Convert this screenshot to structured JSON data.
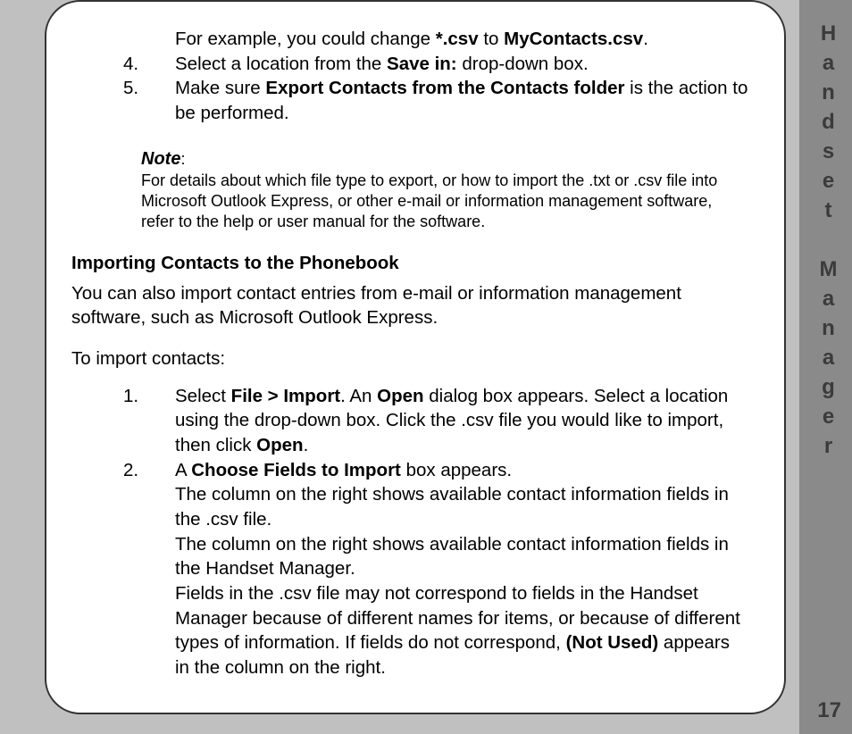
{
  "sideTab": "Handset Manager",
  "pageNumber": "17",
  "topExample": {
    "pre": "For example, you could change ",
    "b1": "*.csv",
    "mid": " to ",
    "b2": "MyContacts.csv",
    "post": "."
  },
  "list1": {
    "item4": {
      "num": "4.",
      "pre": "Select a location from the ",
      "b": "Save in:",
      "post": "  drop-down box."
    },
    "item5": {
      "num": "5.",
      "pre": "Make sure ",
      "b": "Export Contacts from the Contacts folder",
      "post": " is the action to be performed."
    }
  },
  "note": {
    "label": "Note",
    "colon": ":",
    "text": "For details about which file type to export, or how to import the .txt or .csv file into Microsoft Outlook Express, or other e-mail or information management software, refer to the help or user manual for the software."
  },
  "heading": "Importing Contacts to the Phonebook",
  "intro": "You can also import contact entries from e-mail or information management software, such as Microsoft Outlook Express.",
  "toImport": "To import contacts:",
  "list2": {
    "item1": {
      "num": "1.",
      "pre": "Select ",
      "b1": "File > Import",
      "mid1": ". An ",
      "b2": "Open",
      "mid2": " dialog box appears. Select a location using the drop-down box. Click the .csv file you would like to import, then click ",
      "b3": "Open",
      "post": "."
    },
    "item2": {
      "num": "2.",
      "line1pre": "A ",
      "line1b": "Choose Fields to Import",
      "line1post": " box appears.",
      "line2": "The column on the right shows available contact information fields in the .csv file.",
      "line3": "The column on the right shows available contact information fields in the Handset Manager.",
      "line4pre": "Fields in the .csv file may not correspond to fields in the Handset Manager because of different names for items, or because of different types of information. If fields do not correspond, ",
      "line4b": "(Not Used)",
      "line4post": " appears in the column on the right."
    }
  }
}
